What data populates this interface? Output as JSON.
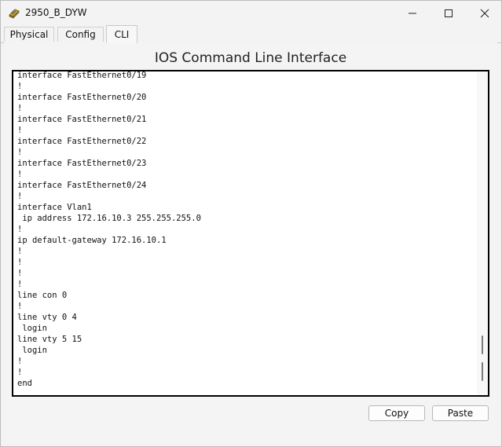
{
  "window": {
    "title": "2950_B_DYW"
  },
  "tabs": [
    {
      "label": "Physical"
    },
    {
      "label": "Config"
    },
    {
      "label": "CLI"
    }
  ],
  "cli": {
    "heading": "IOS Command Line Interface",
    "lines": [
      "interface FastEthernet0/19",
      "!",
      "interface FastEthernet0/20",
      "!",
      "interface FastEthernet0/21",
      "!",
      "interface FastEthernet0/22",
      "!",
      "interface FastEthernet0/23",
      "!",
      "interface FastEthernet0/24",
      "!",
      "interface Vlan1",
      " ip address 172.16.10.3 255.255.255.0",
      "!",
      "ip default-gateway 172.16.10.1",
      "!",
      "!",
      "!",
      "!",
      "line con 0",
      "!",
      "line vty 0 4",
      " login",
      "line vty 5 15",
      " login",
      "!",
      "!",
      "end"
    ]
  },
  "buttons": {
    "copy": "Copy",
    "paste": "Paste"
  },
  "colors": {
    "window_bg": "#f3f3f3",
    "console_bg": "#ffffff",
    "console_border": "#000000"
  },
  "icons": {
    "app": "network-device-icon",
    "minimize": "minimize-icon",
    "maximize": "maximize-icon",
    "close": "close-icon"
  }
}
